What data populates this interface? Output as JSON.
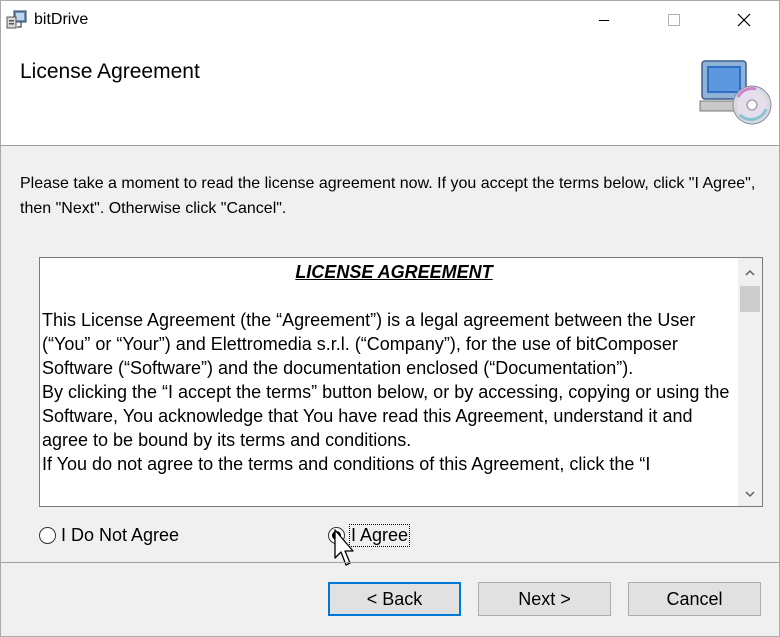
{
  "window": {
    "title": "bitDrive"
  },
  "header": {
    "title": "License Agreement"
  },
  "instructions": "Please take a moment to read the license agreement now. If you accept the terms below, click \"I Agree\", then \"Next\". Otherwise click \"Cancel\".",
  "license": {
    "heading": "LICENSE AGREEMENT",
    "paragraphs": [
      "This License Agreement (the “Agreement”) is a legal agreement between the User (“You” or “Your”) and Elettromedia s.r.l. (“Company”), for the use of bitComposer Software (“Software”) and the documentation enclosed (“Documentation”).",
      "By clicking the “I accept the terms” button below, or by accessing, copying or using the Software, You acknowledge that You have read this Agreement, understand it and agree to be bound by its terms and conditions.",
      "If You do not agree to the terms and conditions of this Agreement, click the “I"
    ]
  },
  "options": {
    "disagree": "I Do Not Agree",
    "agree": "I Agree",
    "selected": "agree"
  },
  "buttons": {
    "back": "< Back",
    "next": "Next >",
    "cancel": "Cancel"
  },
  "icons": {
    "app": "setup-icon",
    "header": "computer-cd-icon"
  }
}
